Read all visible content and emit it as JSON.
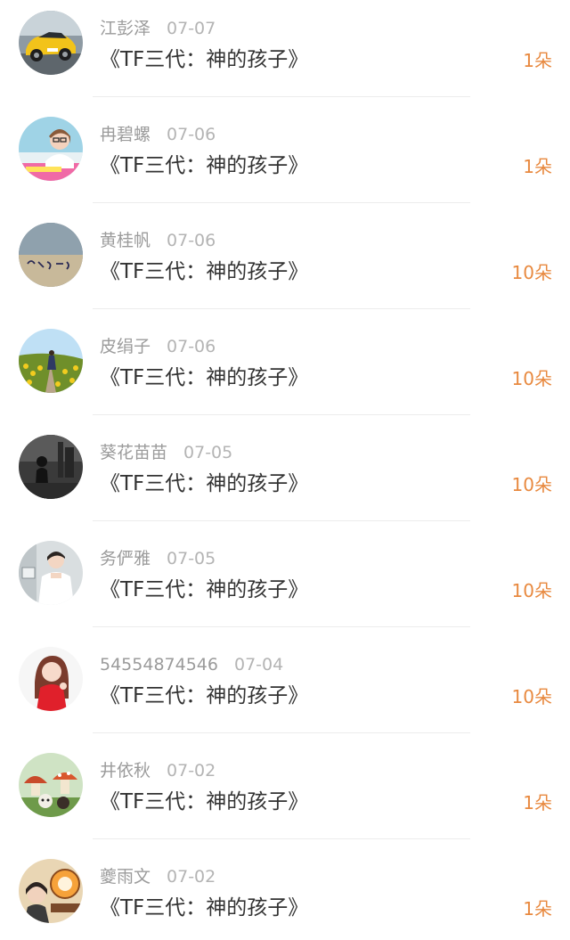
{
  "comments": [
    {
      "user": "江彭泽",
      "date": "07-07",
      "title": "《TF三代：神的孩子》",
      "gift": "1朵",
      "avatar_icon": "yellow-sports-car-avatar"
    },
    {
      "user": "冉碧螺",
      "date": "07-06",
      "title": "《TF三代：神的孩子》",
      "gift": "1朵",
      "avatar_icon": "girl-with-glasses-avatar"
    },
    {
      "user": "黄桂帆",
      "date": "07-06",
      "title": "《TF三代：神的孩子》",
      "gift": "10朵",
      "avatar_icon": "handwritten-sign-avatar"
    },
    {
      "user": "皮绢子",
      "date": "07-06",
      "title": "《TF三代：神的孩子》",
      "gift": "10朵",
      "avatar_icon": "flower-field-avatar"
    },
    {
      "user": "葵花苗苗",
      "date": "07-05",
      "title": "《TF三代：神的孩子》",
      "gift": "10朵",
      "avatar_icon": "dark-silhouette-avatar"
    },
    {
      "user": "务俨雅",
      "date": "07-05",
      "title": "《TF三代：神的孩子》",
      "gift": "10朵",
      "avatar_icon": "boy-white-shirt-avatar"
    },
    {
      "user": "54554874546",
      "date": "07-04",
      "title": "《TF三代：神的孩子》",
      "gift": "10朵",
      "avatar_icon": "girl-red-dress-avatar"
    },
    {
      "user": "井依秋",
      "date": "07-02",
      "title": "《TF三代：神的孩子》",
      "gift": "1朵",
      "avatar_icon": "mushroom-toys-avatar"
    },
    {
      "user": "夔雨文",
      "date": "07-02",
      "title": "《TF三代：神的孩子》",
      "gift": "1朵",
      "avatar_icon": "cartoon-logo-avatar"
    }
  ],
  "colors": {
    "username": "#9b9b9b",
    "date": "#b4b4b4",
    "title": "#333333",
    "gift": "#e8893f",
    "divider": "#ececec"
  }
}
